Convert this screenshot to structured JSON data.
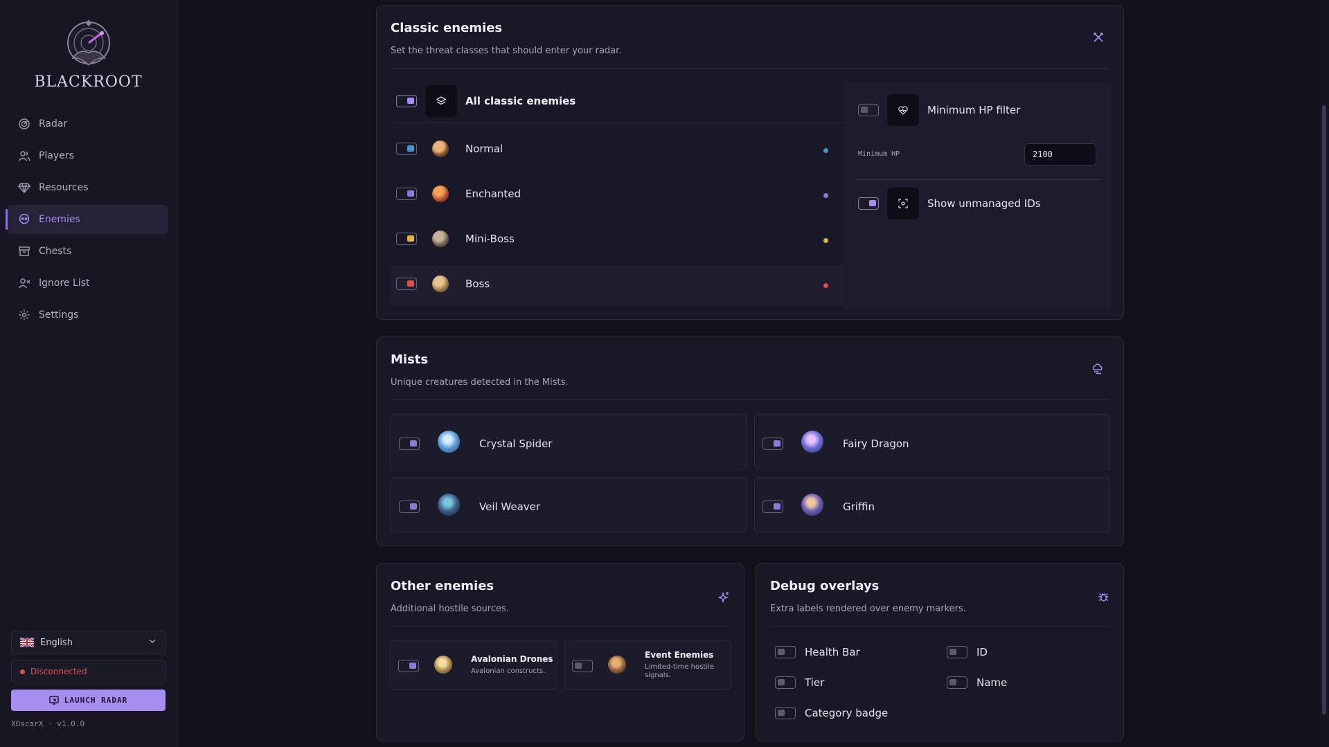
{
  "app": {
    "name": "BLACKROOT",
    "version": "XOscarX · v1.0.0"
  },
  "sidebar": {
    "items": [
      {
        "label": "Radar",
        "icon": "radar-icon"
      },
      {
        "label": "Players",
        "icon": "users-icon"
      },
      {
        "label": "Resources",
        "icon": "gem-icon"
      },
      {
        "label": "Enemies",
        "icon": "skull-icon",
        "active": true
      },
      {
        "label": "Chests",
        "icon": "archive-icon"
      },
      {
        "label": "Ignore List",
        "icon": "user-x-icon"
      },
      {
        "label": "Settings",
        "icon": "gear-icon"
      }
    ],
    "language": "English",
    "status": "Disconnected",
    "launch_label": "LAUNCH RADAR"
  },
  "colors": {
    "accent": "#a98cf0",
    "normal": "#4a93c8",
    "enchanted": "#8c7bd6",
    "miniboss": "#e2b33f",
    "boss": "#d94e4e",
    "disconnected": "#d94e4e"
  },
  "classic": {
    "title": "Classic enemies",
    "subtitle": "Set the threat classes that should enter your radar.",
    "all_label": "All classic enemies",
    "tiers": [
      {
        "label": "Normal",
        "on": true
      },
      {
        "label": "Enchanted",
        "on": true
      },
      {
        "label": "Mini-Boss",
        "on": true
      },
      {
        "label": "Boss",
        "on": true
      }
    ],
    "min_hp_filter_label": "Minimum HP filter",
    "min_hp_label": "Minimum HP",
    "min_hp_value": "2100",
    "show_unmanaged_label": "Show unmanaged IDs"
  },
  "mists": {
    "title": "Mists",
    "subtitle": "Unique creatures detected in the Mists.",
    "creatures": [
      "Crystal Spider",
      "Fairy Dragon",
      "Veil Weaver",
      "Griffin"
    ]
  },
  "other": {
    "title": "Other enemies",
    "subtitle": "Additional hostile sources.",
    "items": [
      {
        "name": "Avalonian Drones",
        "desc": "Avalonian constructs."
      },
      {
        "name": "Event Enemies",
        "desc": "Limited-time hostile signals."
      }
    ]
  },
  "debug": {
    "title": "Debug overlays",
    "subtitle": "Extra labels rendered over enemy markers.",
    "options": [
      "Health Bar",
      "ID",
      "Tier",
      "Name",
      "Category badge"
    ]
  }
}
